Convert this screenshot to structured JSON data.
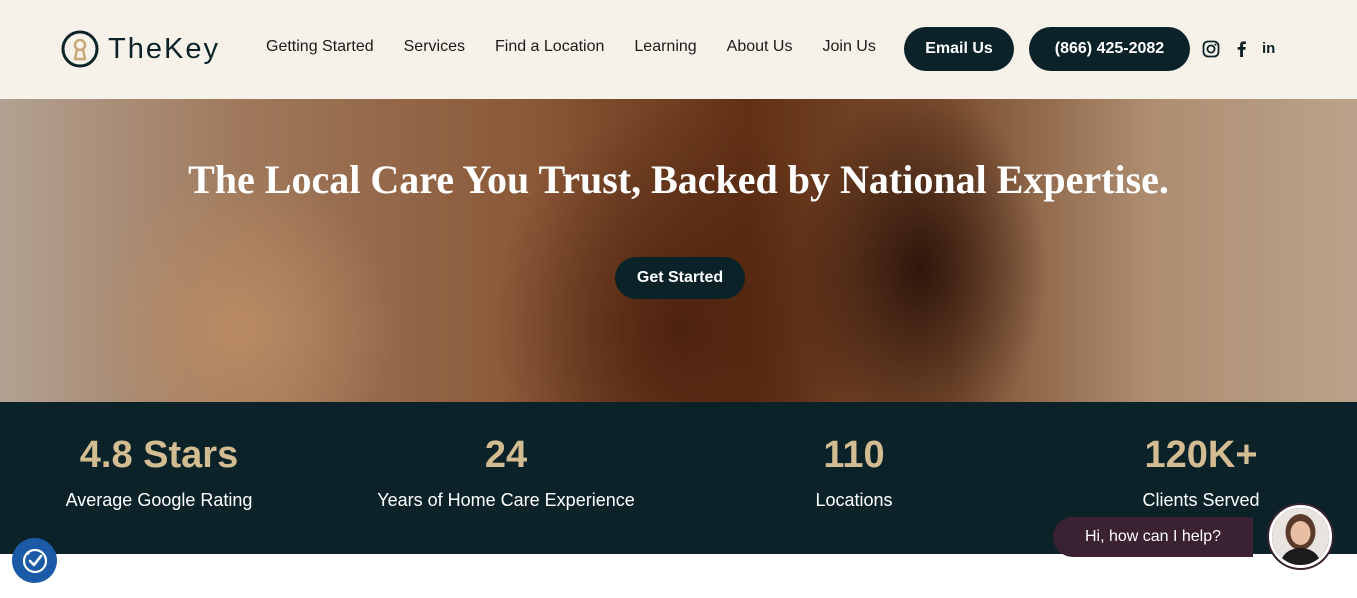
{
  "header": {
    "logo_text": "TheKey",
    "nav": [
      "Getting Started",
      "Services",
      "Find a Location",
      "Learning",
      "About Us",
      "Join Us"
    ],
    "email_label": "Email Us",
    "phone_label": "(866) 425-2082",
    "social": [
      "instagram-icon",
      "facebook-icon",
      "linkedin-icon"
    ],
    "linkedin_glyph": "in"
  },
  "hero": {
    "title": "The Local Care You Trust, Backed by National Expertise.",
    "cta_label": "Get Started"
  },
  "stats": [
    {
      "value": "4.8 Stars",
      "label": "Average Google Rating"
    },
    {
      "value": "24",
      "label": "Years of Home Care Experience"
    },
    {
      "value": "110",
      "label": "Locations"
    },
    {
      "value": "120K+",
      "label": "Clients Served"
    }
  ],
  "chat": {
    "prompt": "Hi, how can I help?"
  },
  "colors": {
    "brand_dark": "#0b2328",
    "accent_gold": "#d4bc92",
    "header_bg": "#f6f2ea",
    "chat_bg": "#3a2233",
    "a11y_blue": "#1a5aa6"
  }
}
